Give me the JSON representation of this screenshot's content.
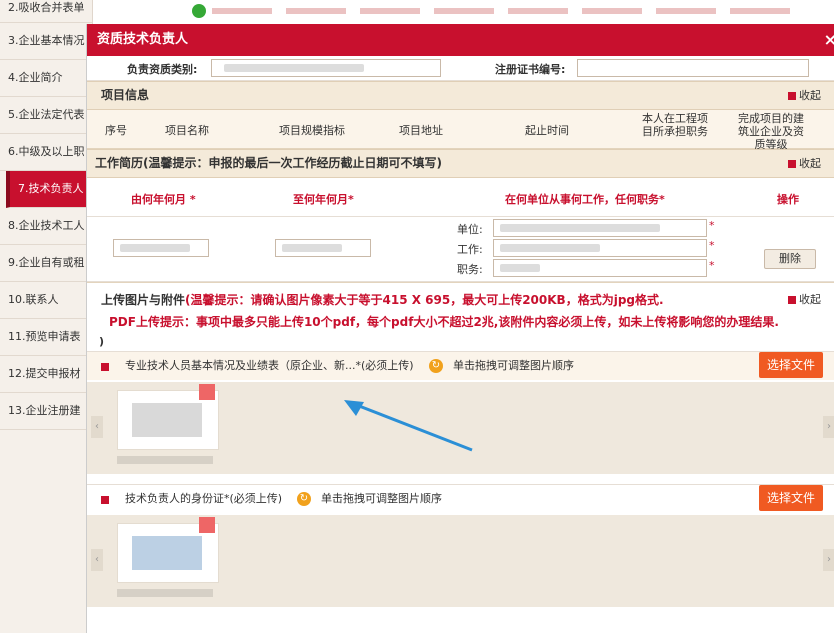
{
  "sidebar": {
    "items": [
      {
        "label": "2.吸收合并表单"
      },
      {
        "label": "3.企业基本情况"
      },
      {
        "label": "4.企业简介"
      },
      {
        "label": "5.企业法定代表"
      },
      {
        "label": "6.中级及以上职"
      },
      {
        "label": "7.技术负责人",
        "active": true
      },
      {
        "label": "8.企业技术工人"
      },
      {
        "label": "9.企业自有或租"
      },
      {
        "label": "10.联系人"
      },
      {
        "label": "11.预览申请表"
      },
      {
        "label": "12.提交申报材"
      },
      {
        "label": "13.企业注册建"
      }
    ]
  },
  "dialog": {
    "title": "资质技术负责人",
    "close_icon": "×",
    "fields": {
      "qual_category_label": "负责资质类别:",
      "cert_no_label": "注册证书编号:"
    },
    "project_info": {
      "title": "项目信息",
      "collapse": "收起",
      "columns": [
        "序号",
        "项目名称",
        "项目规模指标",
        "项目地址",
        "起止时间",
        "本人在工程项目所承担职务",
        "完成项目的建筑业企业及资质等级"
      ]
    },
    "work_history": {
      "title": "工作简历(温馨提示：申报的最后一次工作经历截止日期可不填写)",
      "collapse": "收起",
      "columns": [
        "由何年何月 *",
        "至何年何月*",
        "在何单位从事何工作，任何职务*",
        "操作"
      ],
      "unit_label": "单位:",
      "work_label": "工作:",
      "duty_label": "职务:",
      "star": "*",
      "delete_label": "删除"
    },
    "upload": {
      "title": "上传图片与附件",
      "tip1": "(温馨提示：请确认图片像素大于等于415 X 695，最大可上传200KB，格式为jpg格式.",
      "tip2": "PDF上传提示：事项中最多只能上传10个pdf，每个pdf大小不超过2兆,该附件内容必须上传，如未上传将影响您的办理结果.",
      "paren": ")",
      "collapse": "收起",
      "files": [
        {
          "label": "专业技术人员基本情况及业绩表（原企业、新...*(必须上传)",
          "drag_hint": "单击拖拽可调整图片顺序",
          "button": "选择文件"
        },
        {
          "label": "技术负责人的身份证*(必须上传)",
          "drag_hint": "单击拖拽可调整图片顺序",
          "button": "选择文件"
        }
      ]
    }
  },
  "colors": {
    "accent": "#c8102e",
    "button": "#f05a22",
    "arrow": "#2b8fd6"
  }
}
